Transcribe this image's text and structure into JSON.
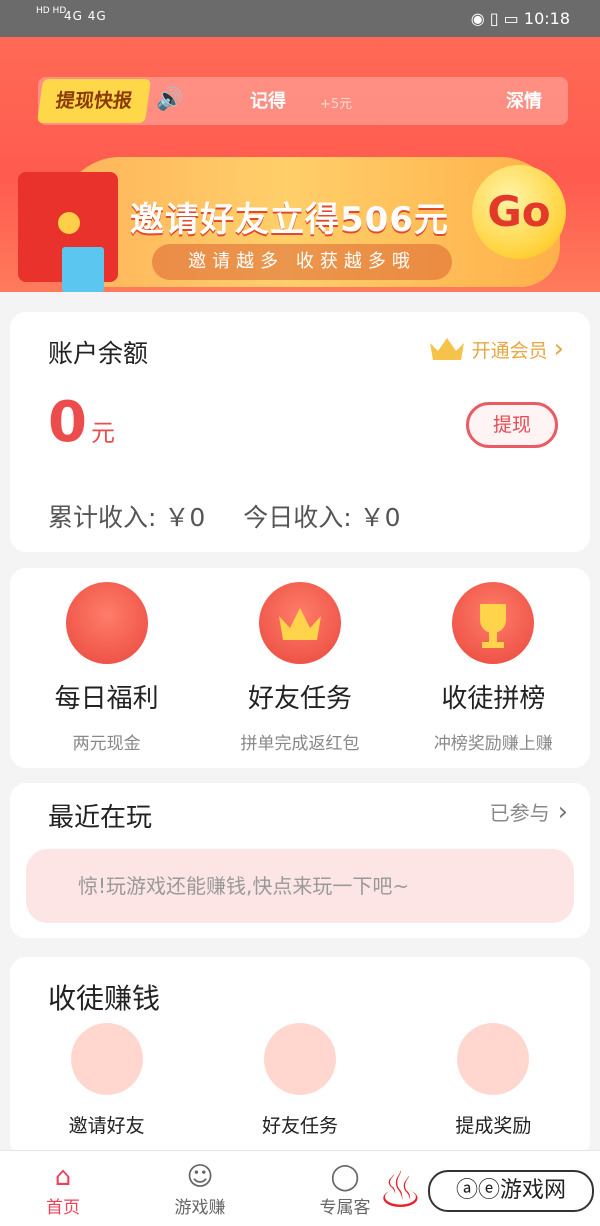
{
  "status_bar": {
    "left_badges": "HD HD",
    "signal": "4G 4G",
    "time": "10:18"
  },
  "banner": {
    "flash_tag": "提现快报",
    "flash_name": "记得",
    "flash_amount": "+5元",
    "flash_name2": "深情",
    "invite_title": "邀请好友立得506元",
    "invite_sub": "邀请越多  收获越多哦",
    "go_label": "Go"
  },
  "account": {
    "title": "账户余额",
    "vip_label": "开通会员",
    "balance": "0",
    "balance_unit": "元",
    "withdraw_label": "提现",
    "total_income": "累计收入: ￥0",
    "today_income": "今日收入: ￥0"
  },
  "features": [
    {
      "title": "每日福利",
      "sub": "两元现金"
    },
    {
      "title": "好友任务",
      "sub": "拼单完成返红包"
    },
    {
      "title": "收徒拼榜",
      "sub": "冲榜奖励赚上赚"
    }
  ],
  "recent": {
    "title": "最近在玩",
    "joined_label": "已参与",
    "tip": "惊!玩游戏还能赚钱,快点来玩一下吧~"
  },
  "earn": {
    "title": "收徒赚钱",
    "items": [
      {
        "title": "邀请好友"
      },
      {
        "title": "好友任务"
      },
      {
        "title": "提成奖励"
      }
    ]
  },
  "tabs": [
    {
      "label": "首页",
      "active": true
    },
    {
      "label": "游戏赚",
      "active": false
    },
    {
      "label": "专属客",
      "active": false
    }
  ],
  "watermark": "ⓐⓔ游戏网",
  "colors": {
    "accent": "#f0415a",
    "balance_red": "#ec4c4c",
    "gold": "#e7a842"
  }
}
